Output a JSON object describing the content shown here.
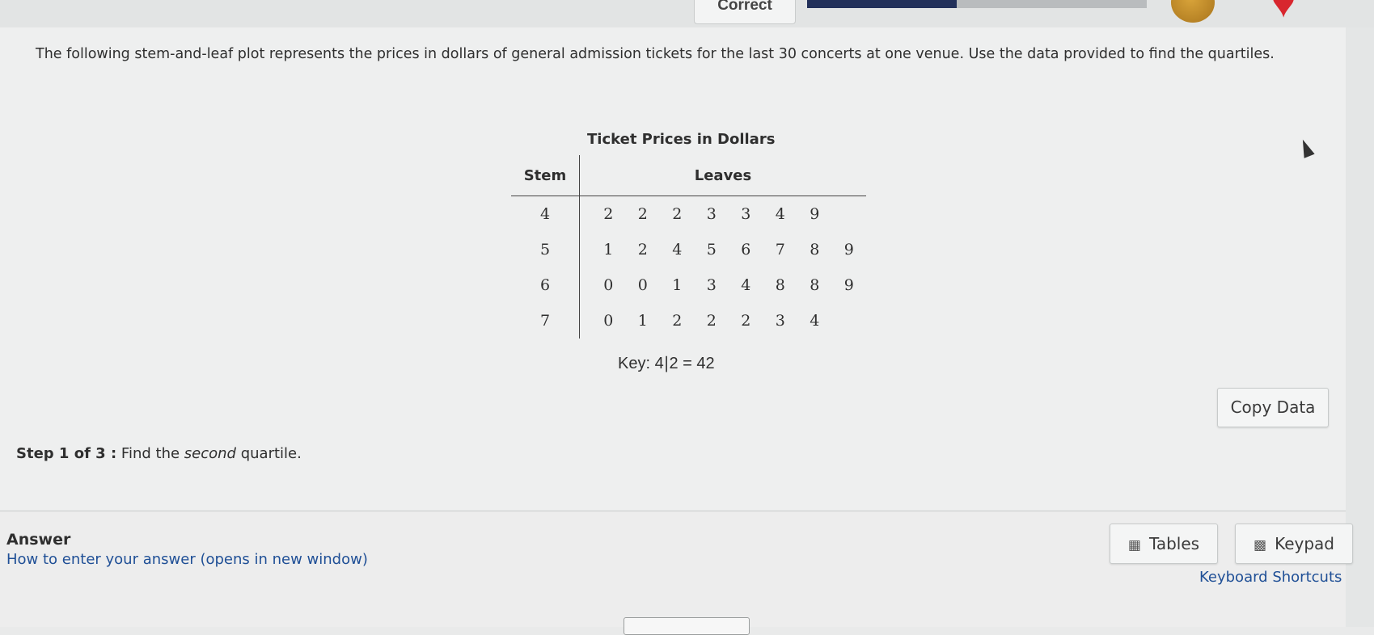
{
  "header": {
    "status_label": "Correct",
    "progress_fraction": 0.44,
    "medal_icon": "medal-icon",
    "heart_icon": "heart-icon"
  },
  "question": {
    "text": "The following stem-and-leaf plot represents the prices in dollars of general admission tickets for the last 30 concerts at one venue. Use the data provided to find the quartiles.",
    "table_title": "Ticket Prices in Dollars",
    "stem_header": "Stem",
    "leaves_header": "Leaves",
    "rows": [
      {
        "stem": "4",
        "leaves": [
          "2",
          "2",
          "2",
          "3",
          "3",
          "4",
          "9"
        ]
      },
      {
        "stem": "5",
        "leaves": [
          "1",
          "2",
          "4",
          "5",
          "6",
          "7",
          "8",
          "9"
        ]
      },
      {
        "stem": "6",
        "leaves": [
          "0",
          "0",
          "1",
          "3",
          "4",
          "8",
          "8",
          "9"
        ]
      },
      {
        "stem": "7",
        "leaves": [
          "0",
          "1",
          "2",
          "2",
          "2",
          "3",
          "4"
        ]
      }
    ],
    "key_label": "Key:",
    "key_stem": "4",
    "key_sep": "|",
    "key_leaf": "2",
    "key_eq": "=",
    "key_value": "42",
    "copy_button": "Copy Data"
  },
  "step": {
    "label": "Step 1 of 3 :",
    "text_prefix": "Find the",
    "text_emph": "second",
    "text_suffix": "quartile."
  },
  "answer": {
    "title": "Answer",
    "howto_link": "How to enter your answer (opens in new window)",
    "tables_button": "Tables",
    "keypad_button": "Keypad",
    "shortcuts_link": "Keyboard Shortcuts"
  },
  "colors": {
    "link": "#1f4f96",
    "progress": "#22305a",
    "heart": "#d8262e"
  }
}
